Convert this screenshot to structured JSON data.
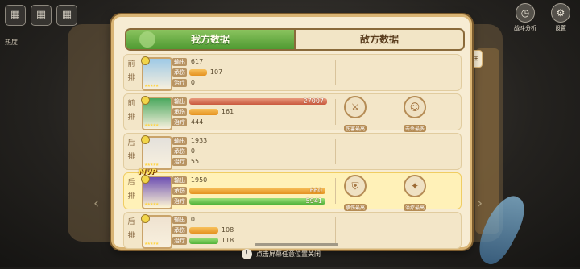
{
  "top_left": {
    "label": "热度",
    "icons": [
      "grid-icon",
      "grid-icon",
      "grid-icon"
    ]
  },
  "top_right": {
    "battle_analysis": "战斗分析",
    "settings": "设置"
  },
  "tabs": {
    "mine": "我方数据",
    "enemy": "敌方数据"
  },
  "stat_labels": {
    "output": "输出",
    "tank": "承伤",
    "heal": "治疗"
  },
  "colors": {
    "accent_green": "#4f9a32",
    "damage": "#c9593e",
    "tank": "#e59220",
    "heal": "#51b33a",
    "mvp_bg": "#fff1b8"
  },
  "rows": [
    {
      "pos": "前\n排",
      "mvp": false,
      "avatar": "#9ec9e6",
      "output": "617",
      "tank": "107",
      "heal": "0",
      "output_frac": 0.0,
      "tank_frac": 0.12,
      "heal_frac": 0.0,
      "achievements": []
    },
    {
      "pos": "前\n排",
      "mvp": false,
      "avatar": "#4aa85e",
      "output": "27007",
      "tank": "161",
      "heal": "444",
      "output_frac": 0.95,
      "tank_frac": 0.2,
      "heal_frac": 0.0,
      "achievements": [
        {
          "label": "伤害最高",
          "icon": "sword-icon"
        },
        {
          "label": "击杀最多",
          "icon": "cat-face-icon"
        }
      ]
    },
    {
      "pos": "后\n排",
      "mvp": false,
      "avatar": "#e4e1dc",
      "output": "1933",
      "tank": "0",
      "heal": "55",
      "output_frac": 0.0,
      "tank_frac": 0.0,
      "heal_frac": 0.0,
      "achievements": []
    },
    {
      "pos": "后\n排",
      "mvp": true,
      "mvp_label": "MVP",
      "avatar": "#6d4fb3",
      "output": "1950",
      "tank": "660",
      "heal": "5941",
      "output_frac": 0.0,
      "tank_frac": 0.94,
      "heal_frac": 0.94,
      "achievements": [
        {
          "label": "承伤最高",
          "icon": "shield-icon"
        },
        {
          "label": "治疗最高",
          "icon": "sparkle-icon"
        }
      ]
    },
    {
      "pos": "后\n排",
      "mvp": false,
      "avatar": "#efe2d0",
      "output": "0",
      "tank": "108",
      "heal": "118",
      "output_frac": 0.0,
      "tank_frac": 0.2,
      "heal_frac": 0.2,
      "achievements": []
    }
  ],
  "hint": "点击屏幕任意位置关闭"
}
